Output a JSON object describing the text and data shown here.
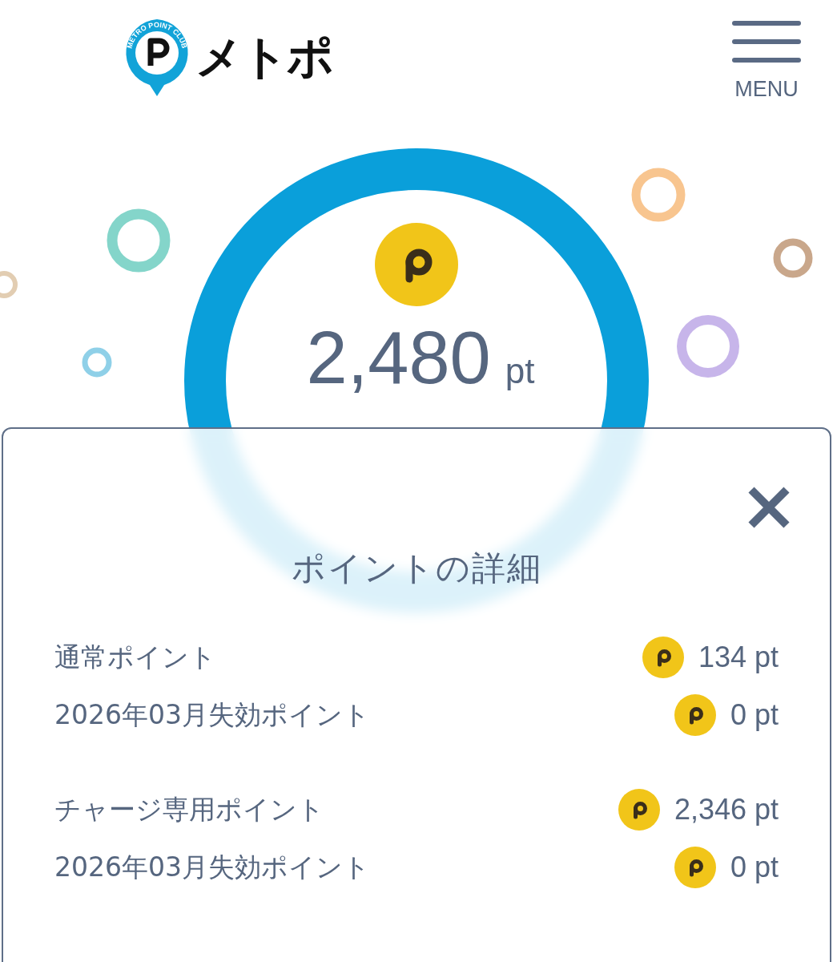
{
  "header": {
    "logo": {
      "tagline": "METRO POINT CLUB",
      "text": "メトポ"
    },
    "menu_label": "MENU"
  },
  "balance": {
    "amount": "2,480",
    "unit": "pt"
  },
  "modal": {
    "title": "ポイントの詳細",
    "groups": [
      {
        "rows": [
          {
            "label": "通常ポイント",
            "value": "134 pt"
          },
          {
            "label": "2026年03月失効ポイント",
            "value": "0 pt"
          }
        ]
      },
      {
        "rows": [
          {
            "label": "チャージ専用ポイント",
            "value": "2,346 pt"
          },
          {
            "label": "2026年03月失効ポイント",
            "value": "0 pt"
          }
        ]
      }
    ]
  }
}
